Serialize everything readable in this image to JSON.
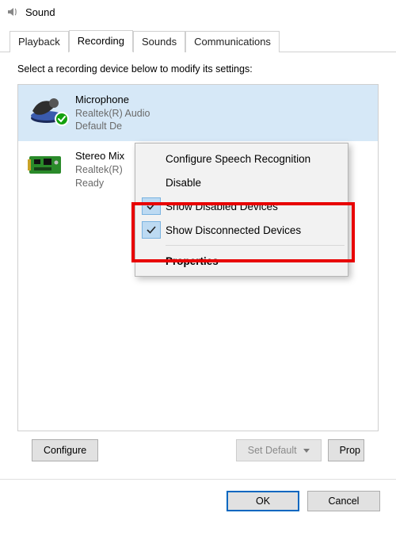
{
  "window": {
    "title": "Sound"
  },
  "tabs": {
    "playback": "Playback",
    "recording": "Recording",
    "sounds": "Sounds",
    "communications": "Communications",
    "active": "recording"
  },
  "panel": {
    "prompt": "Select a recording device below to modify its settings:"
  },
  "devices": [
    {
      "name": "Microphone",
      "driver": "Realtek(R) Audio",
      "status": "Default De"
    },
    {
      "name": "Stereo Mix",
      "driver": "Realtek(R)",
      "status": "Ready"
    }
  ],
  "context_menu": {
    "configure_speech": "Configure Speech Recognition",
    "disable": "Disable",
    "show_disabled": "Show Disabled Devices",
    "show_disconnected": "Show Disconnected Devices",
    "properties": "Properties"
  },
  "buttons": {
    "configure": "Configure",
    "set_default": "Set Default",
    "properties": "Prop"
  },
  "footer": {
    "ok": "OK",
    "cancel": "Cancel"
  }
}
